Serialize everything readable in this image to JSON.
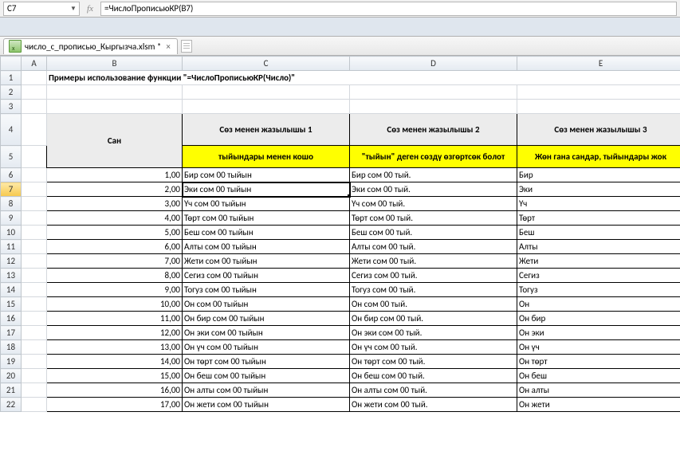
{
  "namebox": "C7",
  "formula": "=ЧислоПрописьюКР(B7)",
  "file_tab": "число_с_прописью_Кыргызча.xlsm *",
  "col_headers": [
    "A",
    "B",
    "C",
    "D",
    "E"
  ],
  "row_headers": [
    "1",
    "2",
    "3",
    "4",
    "5",
    "6",
    "7",
    "8",
    "9",
    "10",
    "11",
    "12",
    "13",
    "14",
    "15",
    "16",
    "17",
    "18",
    "19",
    "20",
    "21",
    "22"
  ],
  "title": "Примеры использование функции \"=ЧислоПрописьюКР(Число)\"",
  "hdr_B": "Сан",
  "hdr_C": "Сөз менен жазылышы 1",
  "hdr_D": "Сөз менен жазылышы 2",
  "hdr_E": "Сөз менен жазылышы 3",
  "sub_C": "тыйындары менен кошо",
  "sub_D": "\"тыйын\" деген сөздү өзгөртсөк болот",
  "sub_E": "Жөн гана сандар, тыйындары жок",
  "rows": [
    {
      "b": "1,00",
      "c": "Бир сом 00 тыйын",
      "d": "Бир сом 00 тый.",
      "e": "Бир"
    },
    {
      "b": "2,00",
      "c": "Эки сом 00 тыйын",
      "d": "Эки сом 00 тый.",
      "e": "Эки"
    },
    {
      "b": "3,00",
      "c": "Үч сом 00 тыйын",
      "d": "Үч сом 00 тый.",
      "e": "Үч"
    },
    {
      "b": "4,00",
      "c": "Төрт сом 00 тыйын",
      "d": "Төрт сом 00 тый.",
      "e": "Төрт"
    },
    {
      "b": "5,00",
      "c": "Беш сом 00 тыйын",
      "d": "Беш сом 00 тый.",
      "e": "Беш"
    },
    {
      "b": "6,00",
      "c": "Алты сом 00 тыйын",
      "d": "Алты сом 00 тый.",
      "e": "Алты"
    },
    {
      "b": "7,00",
      "c": "Жети сом 00 тыйын",
      "d": "Жети сом 00 тый.",
      "e": "Жети"
    },
    {
      "b": "8,00",
      "c": "Сегиз сом 00 тыйын",
      "d": "Сегиз сом 00 тый.",
      "e": "Сегиз"
    },
    {
      "b": "9,00",
      "c": "Тогуз сом 00 тыйын",
      "d": "Тогуз сом 00 тый.",
      "e": "Тогуз"
    },
    {
      "b": "10,00",
      "c": "Он сом 00 тыйын",
      "d": "Он сом 00 тый.",
      "e": "Он"
    },
    {
      "b": "11,00",
      "c": "Он бир сом 00 тыйын",
      "d": "Он бир сом 00 тый.",
      "e": "Он бир"
    },
    {
      "b": "12,00",
      "c": "Он эки сом 00 тыйын",
      "d": "Он эки сом 00 тый.",
      "e": "Он эки"
    },
    {
      "b": "13,00",
      "c": "Он үч сом 00 тыйын",
      "d": "Он үч сом 00 тый.",
      "e": "Он үч"
    },
    {
      "b": "14,00",
      "c": "Он төрт сом 00 тыйын",
      "d": "Он төрт сом 00 тый.",
      "e": "Он төрт"
    },
    {
      "b": "15,00",
      "c": "Он беш сом 00 тыйын",
      "d": "Он беш сом 00 тый.",
      "e": "Он беш"
    },
    {
      "b": "16,00",
      "c": "Он алты сом 00 тыйын",
      "d": "Он алты сом 00 тый.",
      "e": "Он алты"
    },
    {
      "b": "17,00",
      "c": "Он жети сом 00 тыйын",
      "d": "Он жети сом 00 тый.",
      "e": "Он жети"
    }
  ]
}
